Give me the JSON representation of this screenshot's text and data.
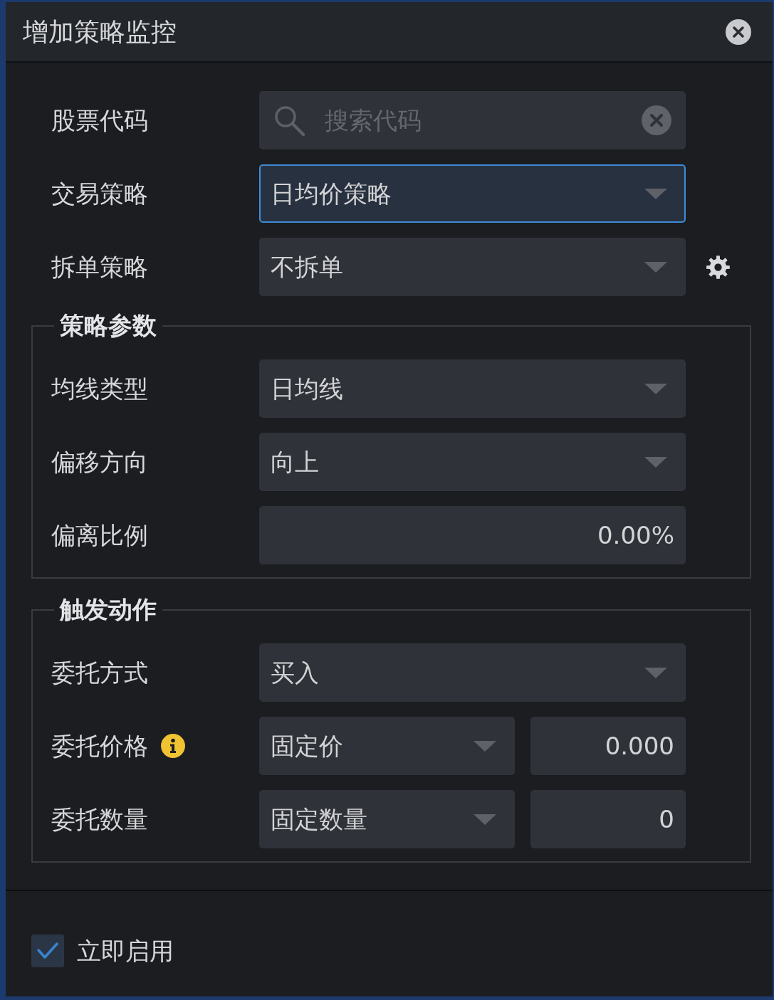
{
  "window": {
    "title": "增加策略监控"
  },
  "top_rows": [
    {
      "label": "股票代码",
      "hint": false,
      "settings": false,
      "controls": [
        {
          "kind": "search",
          "placeholder": "搜索代码",
          "focused": false
        }
      ]
    },
    {
      "label": "交易策略",
      "hint": false,
      "settings": false,
      "controls": [
        {
          "kind": "select",
          "value": "日均价策略",
          "focused": true
        }
      ]
    },
    {
      "label": "拆单策略",
      "hint": false,
      "settings": true,
      "controls": [
        {
          "kind": "select",
          "value": "不拆单",
          "focused": false
        }
      ]
    }
  ],
  "groups": [
    {
      "title": "策略参数",
      "rows": [
        {
          "label": "均线类型",
          "hint": false,
          "settings": false,
          "controls": [
            {
              "kind": "select",
              "value": "日均线",
              "focused": false
            }
          ]
        },
        {
          "label": "偏移方向",
          "hint": false,
          "settings": false,
          "controls": [
            {
              "kind": "select",
              "value": "向上",
              "focused": false
            }
          ]
        },
        {
          "label": "偏离比例",
          "hint": false,
          "settings": false,
          "controls": [
            {
              "kind": "number",
              "value": "0.00%",
              "focused": false
            }
          ]
        }
      ]
    },
    {
      "title": "触发动作",
      "rows": [
        {
          "label": "委托方式",
          "hint": false,
          "settings": false,
          "controls": [
            {
              "kind": "select",
              "value": "买入",
              "focused": false
            }
          ]
        },
        {
          "label": "委托价格",
          "hint": true,
          "settings": false,
          "controls": [
            {
              "kind": "select",
              "value": "固定价",
              "focused": false
            },
            {
              "kind": "number",
              "value": "0.000",
              "focused": false
            }
          ]
        },
        {
          "label": "委托数量",
          "hint": false,
          "settings": false,
          "controls": [
            {
              "kind": "select",
              "value": "固定数量",
              "focused": false
            },
            {
              "kind": "number",
              "value": "0",
              "focused": false
            }
          ]
        }
      ]
    }
  ],
  "footer": {
    "checkbox": {
      "label": "立即启用",
      "checked": true
    }
  }
}
